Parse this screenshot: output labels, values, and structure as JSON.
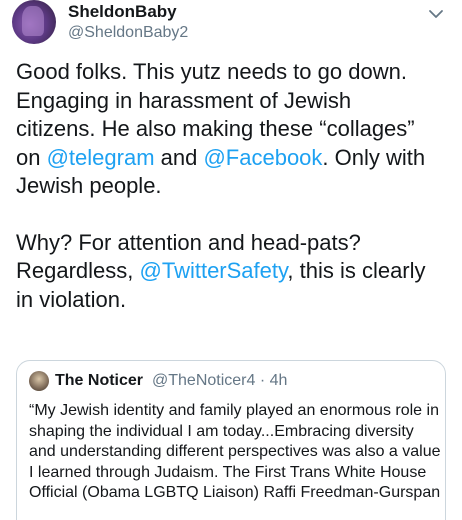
{
  "tweet": {
    "display_name": "SheldonBaby",
    "handle": "@SheldonBaby2",
    "menu_icon": "chevron-down-icon",
    "lines": [
      [
        "Good folks. This yutz needs to go down."
      ],
      [
        "Engaging in harassment of Jewish"
      ],
      [
        "citizens. He also making these “collages”"
      ]
    ],
    "line4_on": "on ",
    "mention_telegram": "@telegram",
    "line4_and": " and ",
    "mention_facebook": "@Facebook",
    "line4_end": ". Only with",
    "line5": "Jewish people.",
    "line6": "Why? For attention and head-pats?",
    "line7_start": "Regardless, ",
    "mention_twittersafety": "@TwitterSafety",
    "line7_end": ", this is clearly",
    "line8": "in violation."
  },
  "quoted_tweet": {
    "display_name": "The Noticer",
    "meta": "@TheNoticer4 · 4h",
    "text": "“My Jewish identity and family played an enormous role in shaping the individual I am today...Embracing diversity and understanding different perspectives was also a value I learned through Judaism. The First Trans White House Official (Obama LGBTQ Liaison) Raffi Freedman-Gurspan"
  },
  "colors": {
    "link": "#1da1f2",
    "text": "#14171a",
    "secondary": "#657786",
    "border": "#ccd6dd"
  }
}
